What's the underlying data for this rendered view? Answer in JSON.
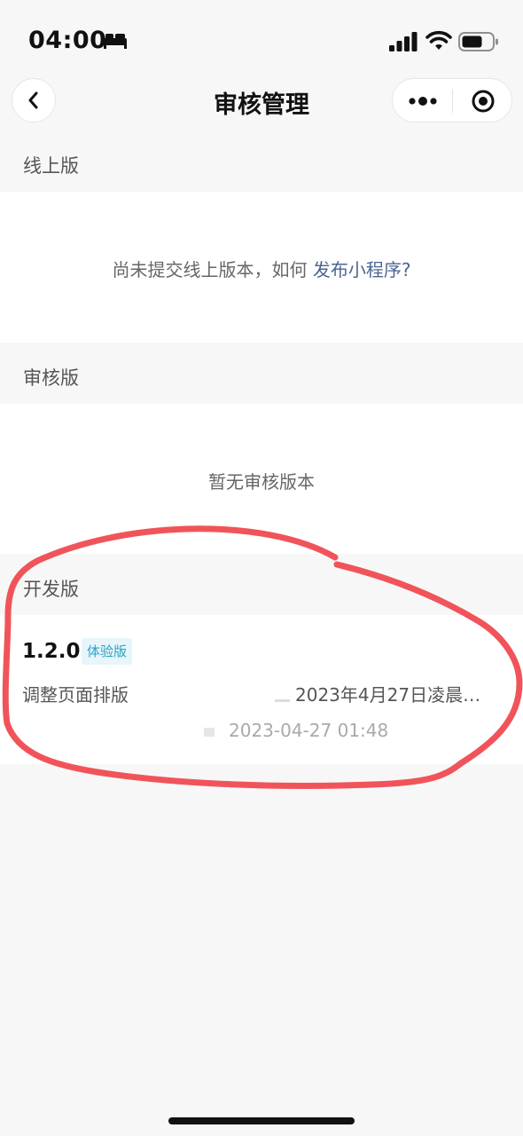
{
  "status_bar": {
    "time": "04:00",
    "focus_icon": "bed-icon",
    "signal_icon": "cellular-signal-icon",
    "wifi_icon": "wifi-icon",
    "battery_icon": "battery-icon"
  },
  "nav": {
    "title": "审核管理",
    "back_icon": "chevron-left-icon",
    "more_icon": "more-dots-icon",
    "close_icon": "target-close-icon"
  },
  "online": {
    "header": "线上版",
    "empty_prefix": "尚未提交线上版本，如何 ",
    "empty_link": "发布小程序?"
  },
  "review": {
    "header": "审核版",
    "empty": "暂无审核版本"
  },
  "dev": {
    "header": "开发版",
    "version": "1.2.0",
    "badge": "体验版",
    "description": "调整页面排版",
    "note": "2023年4月27日凌晨…",
    "time": "2023-04-27 01:48"
  },
  "colors": {
    "accent_link": "#4a6591",
    "badge_text": "#2aa2c7",
    "badge_bg": "#e6f6fb",
    "annotation": "#f0545a"
  }
}
